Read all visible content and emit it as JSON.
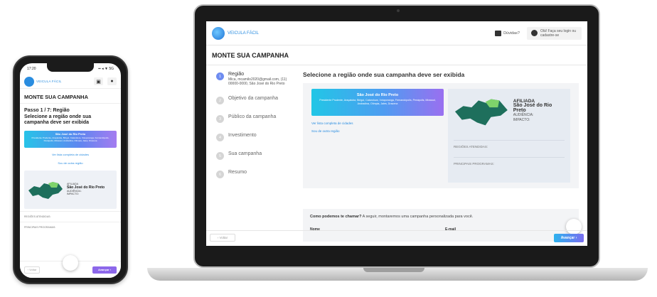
{
  "brand": {
    "logo_text": "VEICULA FÁCIL"
  },
  "phone": {
    "status_time": "17:20",
    "status_icons": "▪▪ ◂ ▼ 5G",
    "title": "MONTE SUA CAMPANHA",
    "step_heading": "Passo 1 / 7: Região",
    "step_question": "Selecione a região onde sua campanha deve ser exibida",
    "region_card_title": "São José do Rio Preto",
    "region_card_desc": "Presidente Prudente, Araçatuba, Birigui, Catanduva, Votuporanga, Fernandópolis, Penápolis, Mirassol, Andradina, Olímpia, Jales, Dracena",
    "link_full_list": "Ver lista completa de cidades",
    "link_other_region": "Sou de outra região",
    "affiliate_label": "AFILIADA",
    "affiliate_city": "São José do Rio Preto",
    "audience_label": "AUDIÊNCIA:",
    "impact_label": "IMPACTO:",
    "regions_label": "REGIÕES ATENDIDAS:",
    "programs_label": "PRINCIPAIS PROGRAMAS:",
    "back_label": "‹ Voltar",
    "next_label": "Avançar ›"
  },
  "laptop": {
    "help_label": "Dúvidas?",
    "login_label": "Olá! Faça seu login ou cadastre-se",
    "page_title": "MONTE SUA CAMPANHA",
    "steps": [
      {
        "num": "1",
        "label": "Região",
        "sub": "Mica, mcamilo2020@gmail.com, (11) 00000-0000, São José do Rio Preto"
      },
      {
        "num": "2",
        "label": "Objetivo da campanha"
      },
      {
        "num": "3",
        "label": "Público da campanha"
      },
      {
        "num": "4",
        "label": "Investimento"
      },
      {
        "num": "5",
        "label": "Sua campanha"
      },
      {
        "num": "6",
        "label": "Resumo"
      }
    ],
    "heading": "Selecione a região onde sua campanha deve ser exibida",
    "region_card_title": "São José do Rio Preto",
    "region_card_desc": "Presidente Prudente, Araçatuba, Birigui, Catanduva, Votuporanga, Fernandópolis, Penápolis, Mirassol, Andradina, Olímpia, Jales, Dracena",
    "link_full_list": "Ver lista completa de cidades",
    "link_other_region": "Sou de outra região",
    "affiliate_label": "AFILIADA",
    "affiliate_city": "São José do Rio Preto",
    "audience_label": "AUDIÊNCIA:",
    "impact_label": "IMPACTO:",
    "regions_label": "REGIÕES ATENDIDAS:",
    "programs_label": "PRINCIPAIS PROGRAMAS:",
    "form_question_bold": "Como podemos te chamar?",
    "form_question_rest": " A seguir, montaremos uma campanha personalizada para você.",
    "name_label": "Nome",
    "email_label": "E-mail",
    "back_label": "‹ Voltar",
    "next_label": "Avançar ›"
  },
  "colors": {
    "accent": "#2a8de0",
    "purple": "#8c67ea",
    "map_green": "#1e6f5c",
    "map_light": "#7fd36b"
  }
}
